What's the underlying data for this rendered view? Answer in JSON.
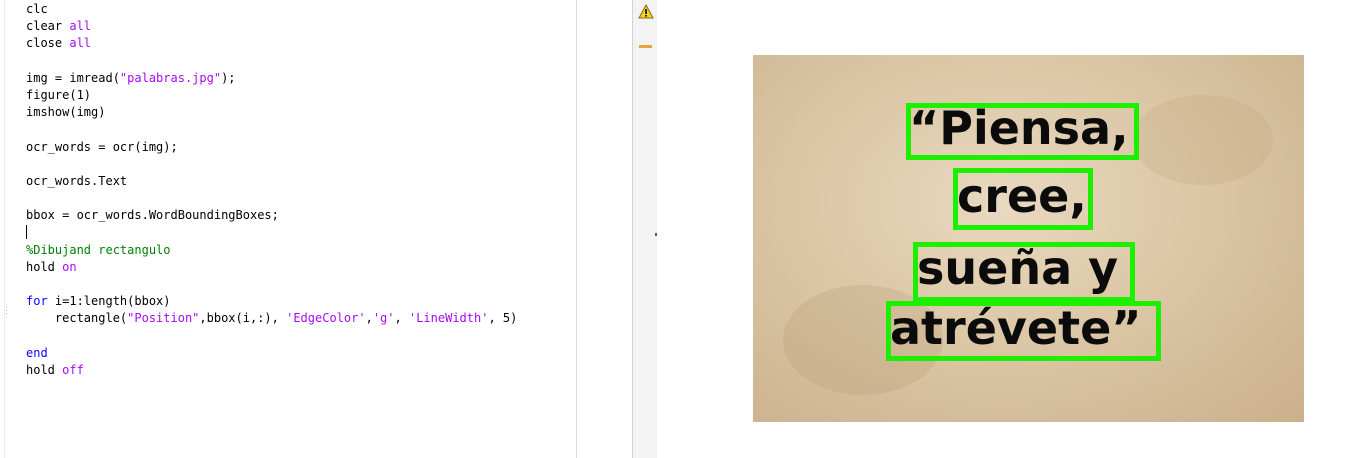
{
  "editor": {
    "lines": [
      [
        {
          "t": "clc",
          "c": ""
        }
      ],
      [
        {
          "t": "clear ",
          "c": ""
        },
        {
          "t": "all",
          "c": "cmdarg"
        }
      ],
      [
        {
          "t": "close ",
          "c": ""
        },
        {
          "t": "all",
          "c": "cmdarg"
        }
      ],
      [],
      [
        {
          "t": "img = imread(",
          "c": ""
        },
        {
          "t": "\"palabras.jpg\"",
          "c": "str"
        },
        {
          "t": ");",
          "c": ""
        }
      ],
      [
        {
          "t": "figure(1)",
          "c": ""
        }
      ],
      [
        {
          "t": "imshow(img)",
          "c": ""
        }
      ],
      [],
      [
        {
          "t": "ocr_words = ocr(img);",
          "c": ""
        }
      ],
      [],
      [
        {
          "t": "ocr_words.Text",
          "c": ""
        }
      ],
      [],
      [
        {
          "t": "bbox = ocr_words.WordBoundingBoxes;",
          "c": ""
        }
      ],
      [
        {
          "t": "",
          "c": "caret"
        }
      ],
      [
        {
          "t": "%Dibujand rectangulo",
          "c": "cmt"
        }
      ],
      [
        {
          "t": "hold ",
          "c": ""
        },
        {
          "t": "on",
          "c": "cmdarg"
        }
      ],
      [],
      [
        {
          "t": "for",
          "c": "kw"
        },
        {
          "t": " i=1:length(bbox)",
          "c": ""
        }
      ],
      [
        {
          "t": "    rectangle(",
          "c": ""
        },
        {
          "t": "\"Position\"",
          "c": "str"
        },
        {
          "t": ",bbox(i,:), ",
          "c": ""
        },
        {
          "t": "'EdgeColor'",
          "c": "str"
        },
        {
          "t": ",",
          "c": ""
        },
        {
          "t": "'g'",
          "c": "str"
        },
        {
          "t": ", ",
          "c": ""
        },
        {
          "t": "'LineWidth'",
          "c": "str"
        },
        {
          "t": ", 5)",
          "c": ""
        }
      ],
      [],
      [
        {
          "t": "end",
          "c": "kw"
        }
      ],
      [
        {
          "t": "hold ",
          "c": ""
        },
        {
          "t": "off",
          "c": "cmdarg"
        }
      ]
    ]
  },
  "analyzer": {
    "warning_icon": "warning-triangle-icon",
    "warning_color": "#e8a33a"
  },
  "figure": {
    "words": [
      "“Piensa,",
      "cree,",
      "sueña y",
      "atrévete”"
    ],
    "box_color": "#1cf000"
  }
}
